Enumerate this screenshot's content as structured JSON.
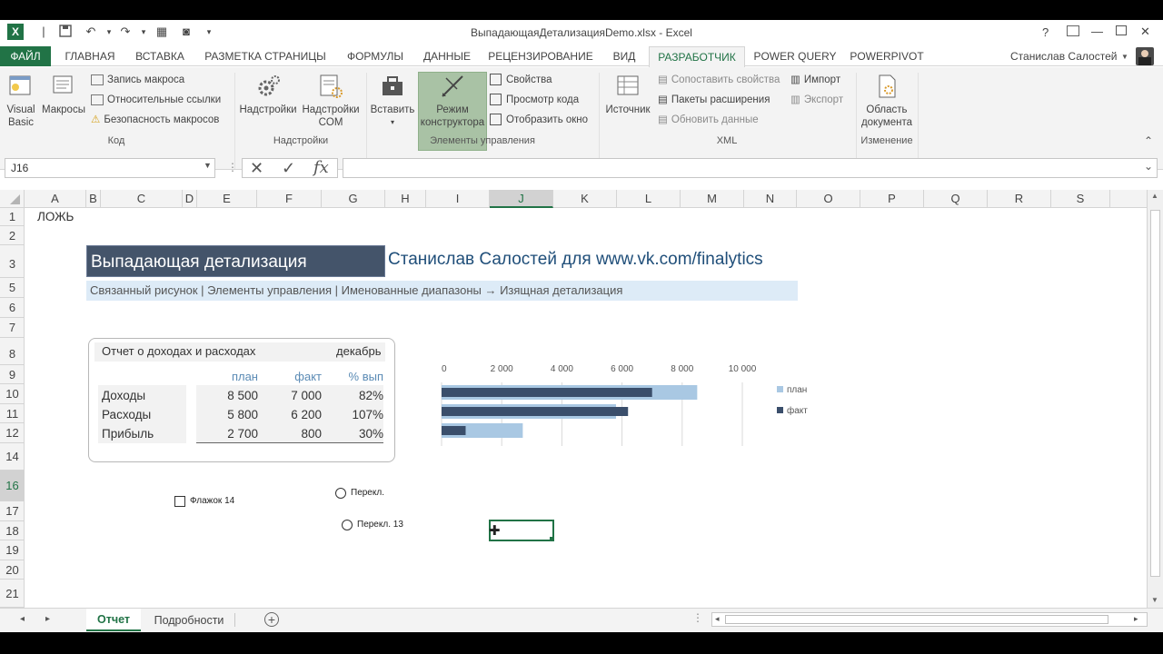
{
  "title_bar": {
    "title": "ВыпадающаяДетализацияDemo.xlsx - Excel",
    "help": "?",
    "minimize": "—",
    "close": "✕"
  },
  "tabs": [
    {
      "label": "ФАЙЛ"
    },
    {
      "label": "ГЛАВНАЯ"
    },
    {
      "label": "ВСТАВКА"
    },
    {
      "label": "РАЗМЕТКА СТРАНИЦЫ"
    },
    {
      "label": "ФОРМУЛЫ"
    },
    {
      "label": "ДАННЫЕ"
    },
    {
      "label": "РЕЦЕНЗИРОВАНИЕ"
    },
    {
      "label": "ВИД"
    },
    {
      "label": "РАЗРАБОТЧИК"
    },
    {
      "label": "POWER QUERY"
    },
    {
      "label": "POWERPIVOT"
    }
  ],
  "user": {
    "name": "Станислав Салостей"
  },
  "ribbon": {
    "code": {
      "visual_basic_1": "Visual",
      "visual_basic_2": "Basic",
      "macros": "Макросы",
      "record": "Запись макроса",
      "relative": "Относительные ссылки",
      "security": "Безопасность макросов",
      "group": "Код"
    },
    "addins": {
      "addins": "Надстройки",
      "com_1": "Надстройки",
      "com_2": "COM",
      "group": "Надстройки"
    },
    "controls": {
      "insert": "Вставить",
      "design_1": "Режим",
      "design_2": "конструктора",
      "properties": "Свойства",
      "view_code": "Просмотр кода",
      "run_dialog": "Отобразить окно",
      "group": "Элементы управления"
    },
    "xml": {
      "source": "Источник",
      "map_props": "Сопоставить свойства",
      "expansion": "Пакеты расширения",
      "refresh": "Обновить данные",
      "import": "Импорт",
      "export": "Экспорт",
      "group": "XML"
    },
    "modify": {
      "panel_1": "Область",
      "panel_2": "документа",
      "group": "Изменение"
    }
  },
  "formula_bar": {
    "name_box": "J16",
    "formula": ""
  },
  "columns": [
    "A",
    "B",
    "C",
    "D",
    "E",
    "F",
    "G",
    "H",
    "I",
    "J",
    "K",
    "L",
    "M",
    "N",
    "O",
    "P",
    "Q",
    "R",
    "S"
  ],
  "rows": [
    "1",
    "2",
    "3",
    "5",
    "6",
    "7",
    "8",
    "9",
    "10",
    "11",
    "12",
    "14",
    "16",
    "17",
    "18",
    "19",
    "20",
    "21"
  ],
  "sheet": {
    "a1": "ЛОЖЬ",
    "banner_title": "Выпадающая детализация",
    "banner_author": "Станислав Салостей для www.vk.com/finalytics",
    "subtitle": "Связанный рисунок | Элементы управления | Именованные диапазоны → Изящная детализация",
    "report": {
      "title": "Отчет о доходах и расходах",
      "month": "декабрь",
      "headers": [
        "план",
        "факт",
        "% вып"
      ],
      "rows": [
        {
          "label": "Доходы",
          "plan": "8 500",
          "fact": "7 000",
          "pct": "82%"
        },
        {
          "label": "Расходы",
          "plan": "5 800",
          "fact": "6 200",
          "pct": "107%"
        },
        {
          "label": "Прибыль",
          "plan": "2 700",
          "fact": "800",
          "pct": "30%"
        }
      ]
    },
    "controls": {
      "checkbox": "Флажок 14",
      "radio1": "Перекл.",
      "radio2": "Перекл. 13"
    }
  },
  "chart_data": {
    "type": "bar",
    "categories": [
      "Доходы",
      "Расходы",
      "Прибыль"
    ],
    "series": [
      {
        "name": "план",
        "values": [
          8500,
          5800,
          2700
        ],
        "color": "#a9c8e3"
      },
      {
        "name": "факт",
        "values": [
          7000,
          6200,
          800
        ],
        "color": "#3a4e6b"
      }
    ],
    "xlim": [
      0,
      10000
    ],
    "x_ticks": [
      "0",
      "2 000",
      "4 000",
      "6 000",
      "8 000",
      "10 000"
    ],
    "legend": "right",
    "grid": true
  },
  "sheet_tabs": [
    {
      "label": "Отчет"
    },
    {
      "label": "Подробности"
    }
  ],
  "colors": {
    "accent": "#217346",
    "banner": "#44546a",
    "author": "#1f4e79",
    "band": "#ddebf7"
  }
}
